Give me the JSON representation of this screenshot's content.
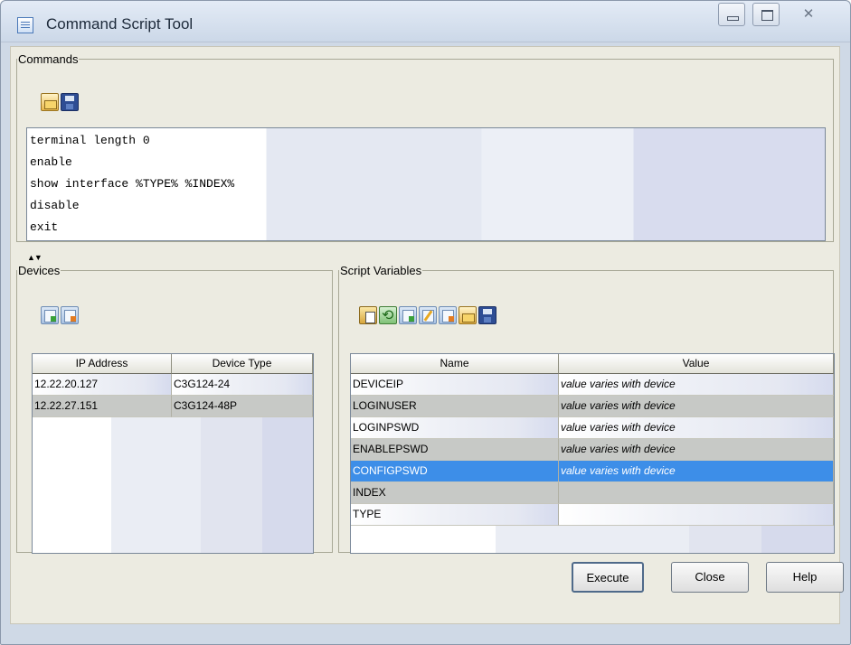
{
  "window": {
    "title": "Command Script Tool"
  },
  "commands": {
    "legend": "Commands",
    "lines": [
      "terminal length 0",
      "enable",
      "show interface %TYPE% %INDEX%",
      "disable",
      "exit"
    ]
  },
  "devices": {
    "legend": "Devices",
    "columns": [
      "IP Address",
      "Device Type"
    ],
    "rows": [
      [
        "12.22.20.127",
        "C3G124-24"
      ],
      [
        "12.22.27.151",
        "C3G124-48P"
      ]
    ]
  },
  "script_variables": {
    "legend": "Script Variables",
    "columns": [
      "Name",
      "Value"
    ],
    "rows": [
      [
        "DEVICEIP",
        "value varies with device"
      ],
      [
        "LOGINUSER",
        "value varies with device"
      ],
      [
        "LOGINPSWD",
        "value varies with device"
      ],
      [
        "ENABLEPSWD",
        "value varies with device"
      ],
      [
        "CONFIGPSWD",
        "value varies with device"
      ],
      [
        "INDEX",
        ""
      ],
      [
        "TYPE",
        ""
      ]
    ],
    "selected_row": "CONFIGPSWD"
  },
  "buttons": {
    "execute": "Execute",
    "close": "Close",
    "help": "Help"
  },
  "colors": {
    "selection": "#3d8ee8",
    "window_bg": "#ecebe1"
  }
}
